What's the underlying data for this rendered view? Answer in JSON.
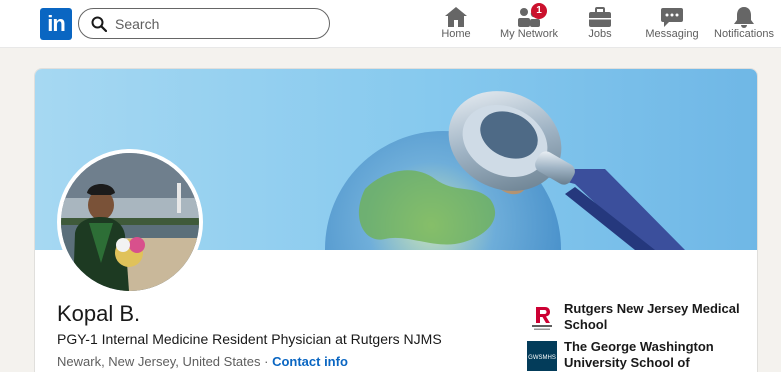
{
  "nav": {
    "logo_text": "in",
    "search_placeholder": "Search",
    "items": [
      {
        "label": "Home",
        "icon": "home-icon",
        "badge": ""
      },
      {
        "label": "My Network",
        "icon": "network-icon",
        "badge": "1"
      },
      {
        "label": "Jobs",
        "icon": "briefcase-icon",
        "badge": ""
      },
      {
        "label": "Messaging",
        "icon": "messaging-icon",
        "badge": ""
      },
      {
        "label": "Notifications",
        "icon": "bell-icon",
        "badge": ""
      }
    ]
  },
  "profile": {
    "name": "Kopal B.",
    "headline": "PGY-1 Internal Medicine Resident Physician at Rutgers NJMS",
    "location": "Newark, New Jersey, United States",
    "separator": " · ",
    "contact_label": "Contact info"
  },
  "education": [
    {
      "name": "Rutgers New Jersey Medical School",
      "logo": "rutgers-logo"
    },
    {
      "name": "The George Washington University School of Medici...",
      "logo": "gwsmhs-logo",
      "logo_text": "GWSMHS"
    }
  ],
  "colors": {
    "brand": "#0a66c2",
    "badge": "#cb112d",
    "banner_sky": "#8fcdee"
  }
}
